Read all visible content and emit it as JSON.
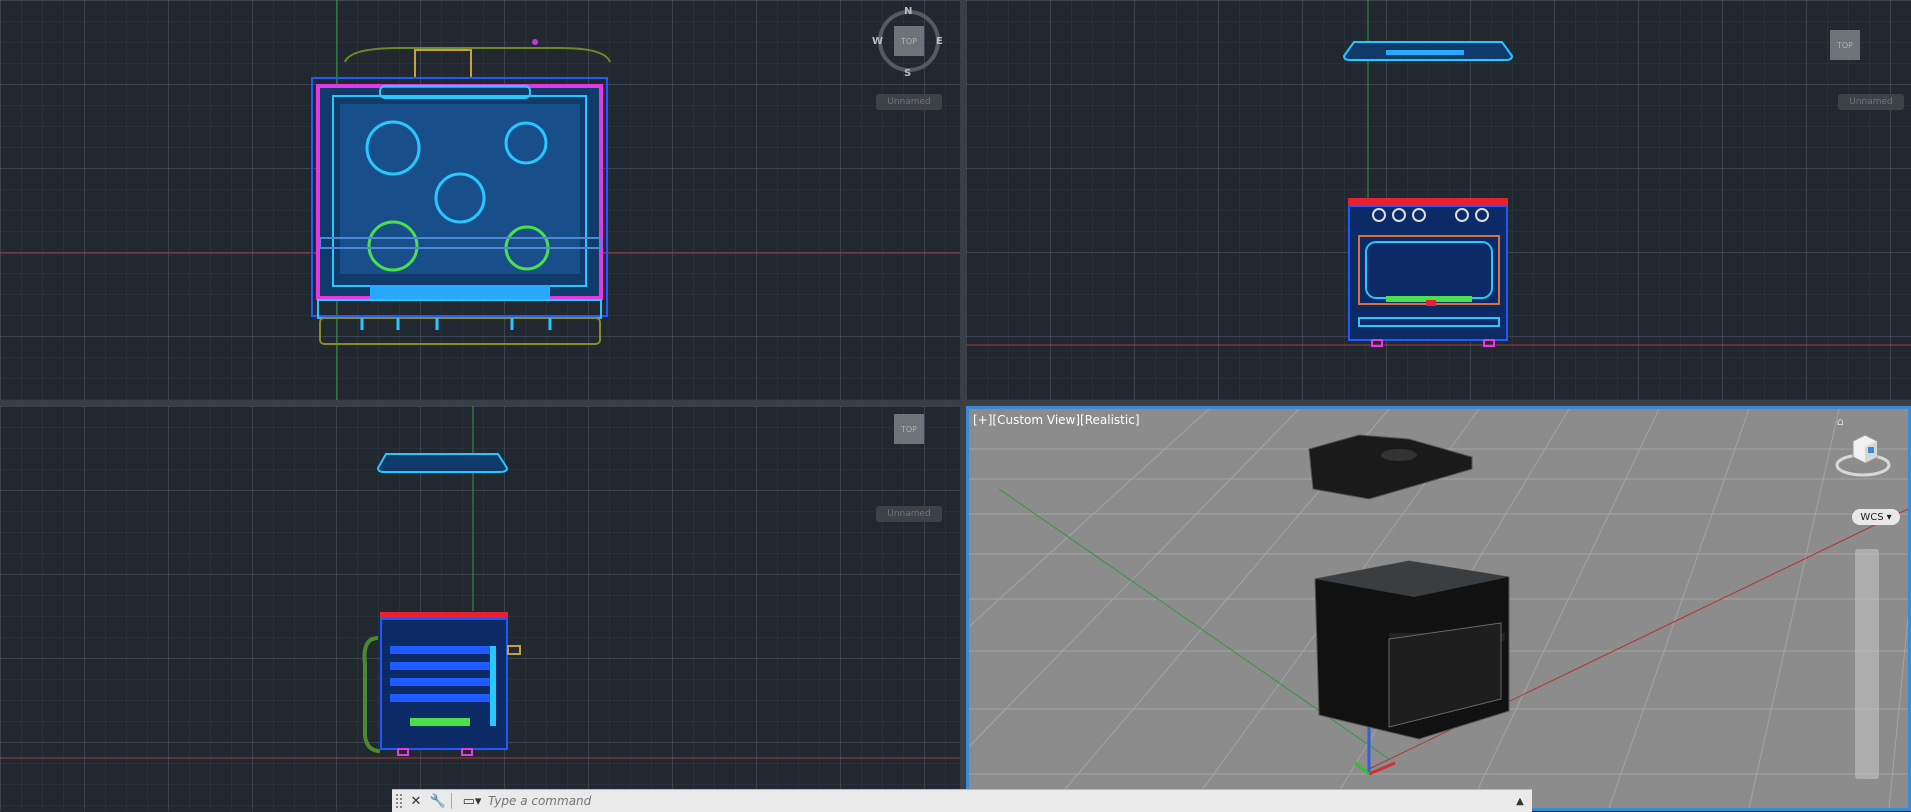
{
  "viewports": {
    "top_left": {
      "compass": {
        "n": "N",
        "s": "S",
        "e": "E",
        "w": "W"
      },
      "cube_face": "TOP",
      "ucs": "Unnamed"
    },
    "top_right": {
      "cube_face": "TOP",
      "ucs": "Unnamed"
    },
    "bottom_left": {
      "cube_face": "TOP",
      "ucs": "Unnamed"
    },
    "bottom_right": {
      "label": "[+][Custom View][Realistic]",
      "coord_system": "WCS"
    }
  },
  "command_line": {
    "placeholder": "Type a command"
  },
  "colors": {
    "accent": "#3b8ad9",
    "background": "#212830",
    "render_bg": "#8c8c8c"
  },
  "icons": [
    "close-icon",
    "wrench-icon",
    "command-prompt-icon",
    "caret-up-icon",
    "home-icon",
    "viewcube-icon"
  ]
}
